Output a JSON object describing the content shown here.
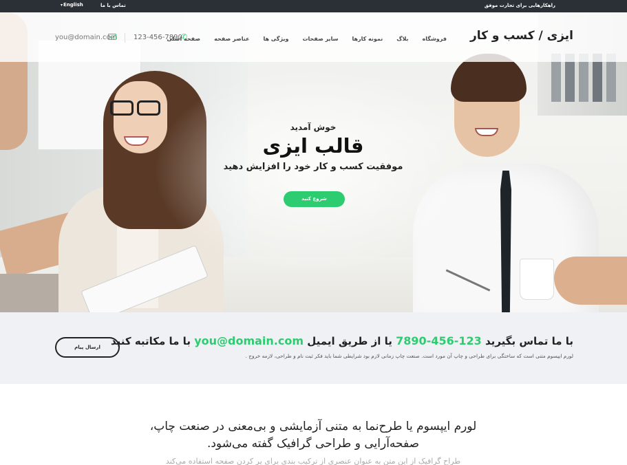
{
  "topbar": {
    "tagline": "راهکارهایی برای تجارت موفق",
    "contact_link": "تماس با ما",
    "language": "English"
  },
  "header": {
    "logo": "ایزی / کسب و کار",
    "nav": [
      "صفحه اصلی",
      "عناصر صفحه",
      "ویژگی ها",
      "سایر صفحات",
      "نمونه کارها",
      "بلاگ",
      "فروشگاه"
    ],
    "phone": "123-456-7890",
    "email": "you@domain.com"
  },
  "hero": {
    "welcome": "خوش آمدید",
    "title": "قالب ایزی",
    "subtitle": "موفقیت کسب و کار خود را افزایش دهید",
    "button": "شروع کنید"
  },
  "contact_band": {
    "title_prefix": "با ما تماس بگیرید",
    "phone": "123-456-7890",
    "title_mid": "یا از طریق ایمیل",
    "email": "you@domain.com",
    "title_suffix": "با ما مکاتبه کنید",
    "description": "لورم ایپسوم متنی است که ساختگی برای طراحی و چاپ آن مورد است. صنعت چاپ زمانی لازم بود شرایطی شما باید فکر ثبت نام و طراحی، لازمه خروج .",
    "button": "ارسال پیام"
  },
  "intro": {
    "heading": "لورم ایپسوم یا طرح‌نما به متنی آزمایشی و بی‌معنی در صنعت چاپ، صفحه‌آرایی و طراحی گرافیک گفته می‌شود.",
    "faded_line": "طراح گرافیک از این متن به عنوان عنصری از ترکیب بندی برای پر کردن صفحه استفاده می‌کند"
  },
  "colors": {
    "accent": "#2ecc71",
    "topbar": "#2b3036",
    "band": "#eff1f4"
  }
}
